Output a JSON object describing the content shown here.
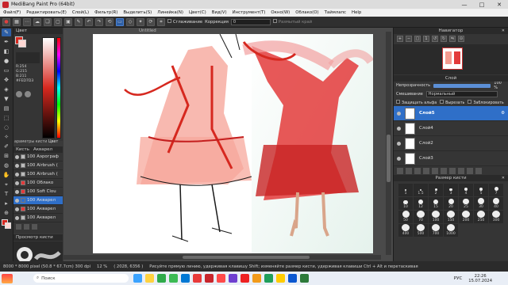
{
  "window": {
    "title": "MediBang Paint Pro (64bit)",
    "controls": [
      "—",
      "□",
      "✕"
    ]
  },
  "menu": [
    "Файл(F)",
    "Редактировать(E)",
    "Слой(L)",
    "Фильтр(R)",
    "Выделить(S)",
    "Линейка(N)",
    "Цвет(C)",
    "Вид(V)",
    "Инструмент(T)",
    "Окно(W)",
    "Облако(O)",
    "Таймлапс",
    "Help"
  ],
  "toolbar": {
    "smoothing_label": "Сглаживание",
    "correction_label": "Коррекция",
    "correction_value": "0",
    "blurred_edge_label": "Размытый край"
  },
  "canvas": {
    "tab_title": "Untitled"
  },
  "color_panel": {
    "title": "Цвет",
    "rgb": [
      "R:254",
      "G:215",
      "B:211"
    ],
    "hex": "#FED7D3",
    "brush_settings_label": "араметры кисти",
    "color_tab": "Цвет"
  },
  "brush_panel": {
    "title": "Кисть",
    "tab2": "Акварел",
    "items": [
      {
        "size": "100",
        "name": "Аэрограф",
        "color": "#bbbbbb",
        "selected": false
      },
      {
        "size": "100",
        "name": "Airbrush (",
        "color": "#bbbbbb",
        "selected": false
      },
      {
        "size": "100",
        "name": "Airbrush (",
        "color": "#bbbbbb",
        "selected": false
      },
      {
        "size": "100",
        "name": "Облако",
        "color": "#e23a3a",
        "selected": false
      },
      {
        "size": "100",
        "name": "Soft Clou",
        "color": "#e23a3a",
        "selected": false
      },
      {
        "size": "100",
        "name": "Акварел",
        "color": "#2e6fd0",
        "selected": true
      },
      {
        "size": "100",
        "name": "Акварел",
        "color": "#e23a3a",
        "selected": false
      },
      {
        "size": "100",
        "name": "Акварел",
        "color": "#bbbbbb",
        "selected": false
      }
    ]
  },
  "preview_panel": {
    "title": "Просмотр кисти"
  },
  "navigator": {
    "title": "Навигатор"
  },
  "layer_panel": {
    "title": "Слой",
    "opacity_label": "Непрозрачность",
    "opacity_value": "100 %",
    "blend_label": "Смешивание",
    "blend_value": "Нормальный",
    "protect_alpha": "Защищать альфа",
    "clip": "Вырезать",
    "lock": "Заблокировать",
    "layers": [
      {
        "name": "Слой5",
        "selected": true
      },
      {
        "name": "Слой4",
        "selected": false
      },
      {
        "name": "Слой2",
        "selected": false
      },
      {
        "name": "Слой3",
        "selected": false
      }
    ]
  },
  "brush_size_panel": {
    "title": "Размер кисти",
    "sizes": [
      "1",
      "1.5",
      "2",
      "3",
      "4",
      "5",
      "7",
      "10",
      "12",
      "15",
      "20",
      "25",
      "30",
      "40",
      "50",
      "70",
      "100",
      "150",
      "200",
      "250",
      "300",
      "400",
      "500",
      "700",
      "1000"
    ]
  },
  "status": {
    "canvas_info": "8000 * 8000 pixel  (50.8 * 67.7cm)  300 dpi",
    "zoom": "12 %",
    "coords": "( 2028, 6356 )",
    "hint": "Рисуйте прямую линию, удерживая клавишу Shift; изменяйте размер кисти, удерживая клавиши Ctrl + Alt и перетаскивая"
  },
  "taskbar": {
    "search_placeholder": "Поиск",
    "lang": "РУС",
    "time": "22:26",
    "date": "15.07.2024"
  },
  "colors": {
    "accent": "#2f6fc8",
    "primary_color": "#d6281f",
    "secondary_color": "#fed7d3"
  }
}
